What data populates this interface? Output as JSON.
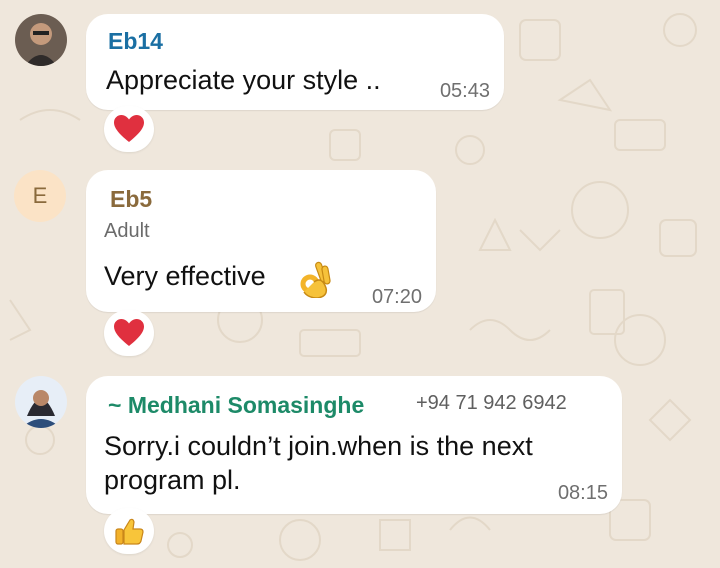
{
  "messages": [
    {
      "sender": "Eb14",
      "sender_color": "#1a6fa3",
      "text": "Appreciate your style ..",
      "time": "05:43",
      "reaction": "heart"
    },
    {
      "avatar_letter": "E",
      "sender": "Eb5",
      "sender_color": "#8a6a3c",
      "subtitle": "Adult",
      "text": "Very effective",
      "emoji": "ok-hand",
      "time": "07:20",
      "reaction": "heart"
    },
    {
      "sender": "~ Medhani Somasinghe",
      "sender_color": "#1d8a68",
      "phone": "+94 71 942 6942",
      "text_lines": [
        "Sorry.i couldn’t join.when  is the next",
        "program pl."
      ],
      "time": "08:15",
      "reaction": "thumbs-up"
    }
  ]
}
